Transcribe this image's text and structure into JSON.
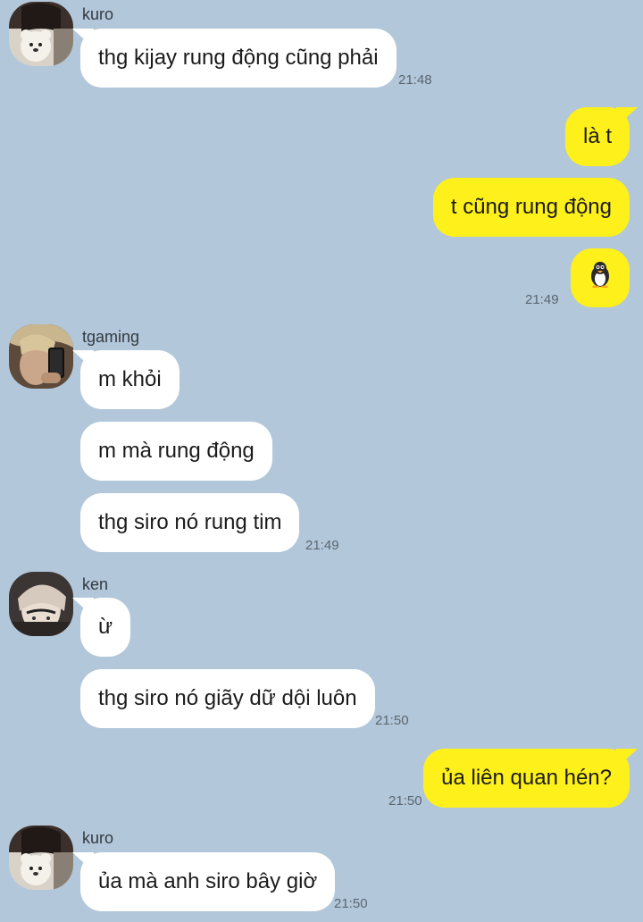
{
  "messages": [
    {
      "sender": "kuro",
      "text": "thg kijay rung động cũng phải",
      "time": "21:48"
    },
    {
      "text": "là t"
    },
    {
      "text": "t cũng rung động"
    },
    {
      "emoji": "penguin-icon",
      "time": "21:49"
    },
    {
      "sender": "tgaming",
      "text": "m khỏi"
    },
    {
      "text": "m mà rung động"
    },
    {
      "text": "thg siro nó rung tim",
      "time": "21:49"
    },
    {
      "sender": "ken",
      "text": "ừ"
    },
    {
      "text": "thg siro nó giãy dữ dội luôn",
      "time": "21:50"
    },
    {
      "text": "ủa liên quan hén?",
      "time": "21:50"
    },
    {
      "sender": "kuro",
      "text": "ủa mà anh siro bây giờ",
      "time": "21:50"
    }
  ],
  "colors": {
    "background": "#b2c7da",
    "incoming_bubble": "#ffffff",
    "outgoing_bubble": "#fef01b"
  }
}
